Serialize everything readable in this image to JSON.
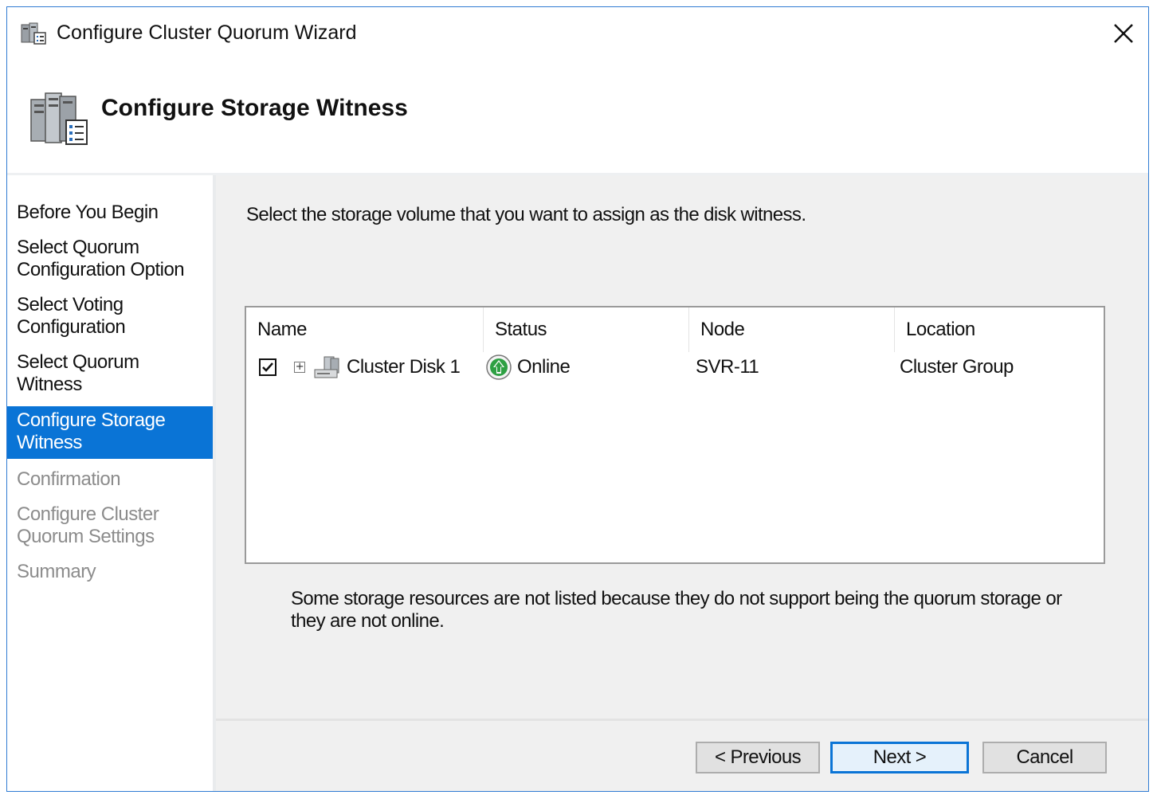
{
  "window": {
    "title": "Configure Cluster Quorum Wizard",
    "page_title": "Configure Storage Witness"
  },
  "sidebar": {
    "steps": [
      {
        "label": "Before You Begin",
        "state": "done"
      },
      {
        "label": "Select Quorum Configuration Option",
        "state": "done"
      },
      {
        "label": "Select Voting Configuration",
        "state": "done"
      },
      {
        "label": "Select Quorum Witness",
        "state": "done"
      },
      {
        "label": "Configure Storage Witness",
        "state": "active"
      },
      {
        "label": "Confirmation",
        "state": "future"
      },
      {
        "label": "Configure Cluster Quorum Settings",
        "state": "future"
      },
      {
        "label": "Summary",
        "state": "future"
      }
    ]
  },
  "main": {
    "instruction": "Select the storage volume that you want to assign as the disk witness.",
    "columns": [
      "Name",
      "Status",
      "Node",
      "Location"
    ],
    "rows": [
      {
        "checked": true,
        "name": "Cluster Disk 1",
        "status": "Online",
        "node": "SVR-11",
        "location": "Cluster Group"
      }
    ],
    "note": "Some storage resources are not listed because they do not support being the quorum storage or they are not online."
  },
  "footer": {
    "previous_label": "< Previous",
    "next_label": "Next >",
    "cancel_label": "Cancel"
  },
  "colors": {
    "accent": "#0a74d6",
    "status_online": "#2ea043"
  }
}
